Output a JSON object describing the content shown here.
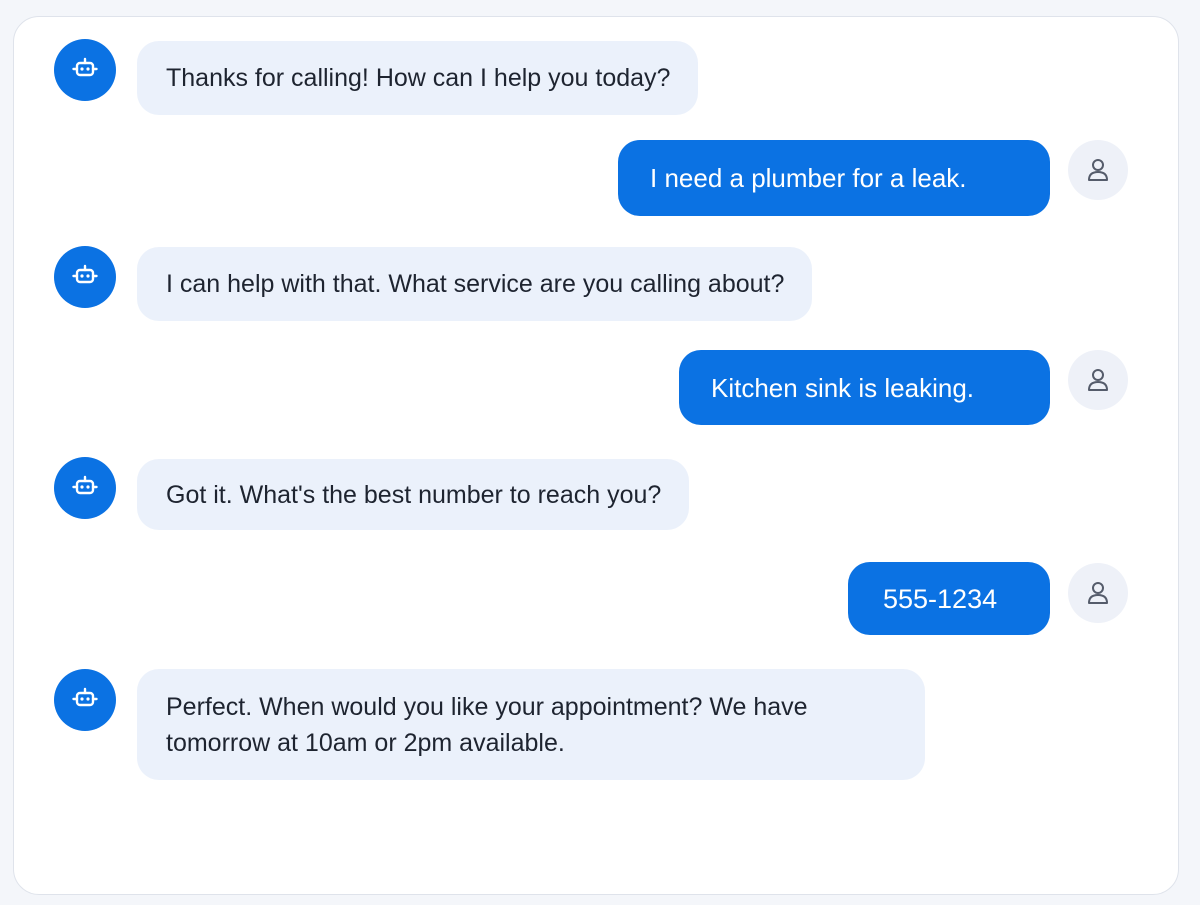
{
  "colors": {
    "bot_avatar_bg": "#0b72e3",
    "user_bubble_bg": "#0b72e3",
    "bot_bubble_bg": "#ebf1fb",
    "user_avatar_bg": "#eef1f8"
  },
  "icons": {
    "bot": "robot-icon",
    "user": "user-icon"
  },
  "messages": [
    {
      "sender": "bot",
      "text": "Thanks for calling! How can I help you today?"
    },
    {
      "sender": "user",
      "text": "I need a plumber for a leak."
    },
    {
      "sender": "bot",
      "text": "I can help with that. What service are you calling about?"
    },
    {
      "sender": "user",
      "text": "Kitchen sink is leaking."
    },
    {
      "sender": "bot",
      "text": "Got it. What's the best number to reach you?"
    },
    {
      "sender": "user",
      "text": "555-1234"
    },
    {
      "sender": "bot",
      "text": "Perfect. When would you like your appointment? We have tomorrow at 10am or 2pm available."
    }
  ]
}
